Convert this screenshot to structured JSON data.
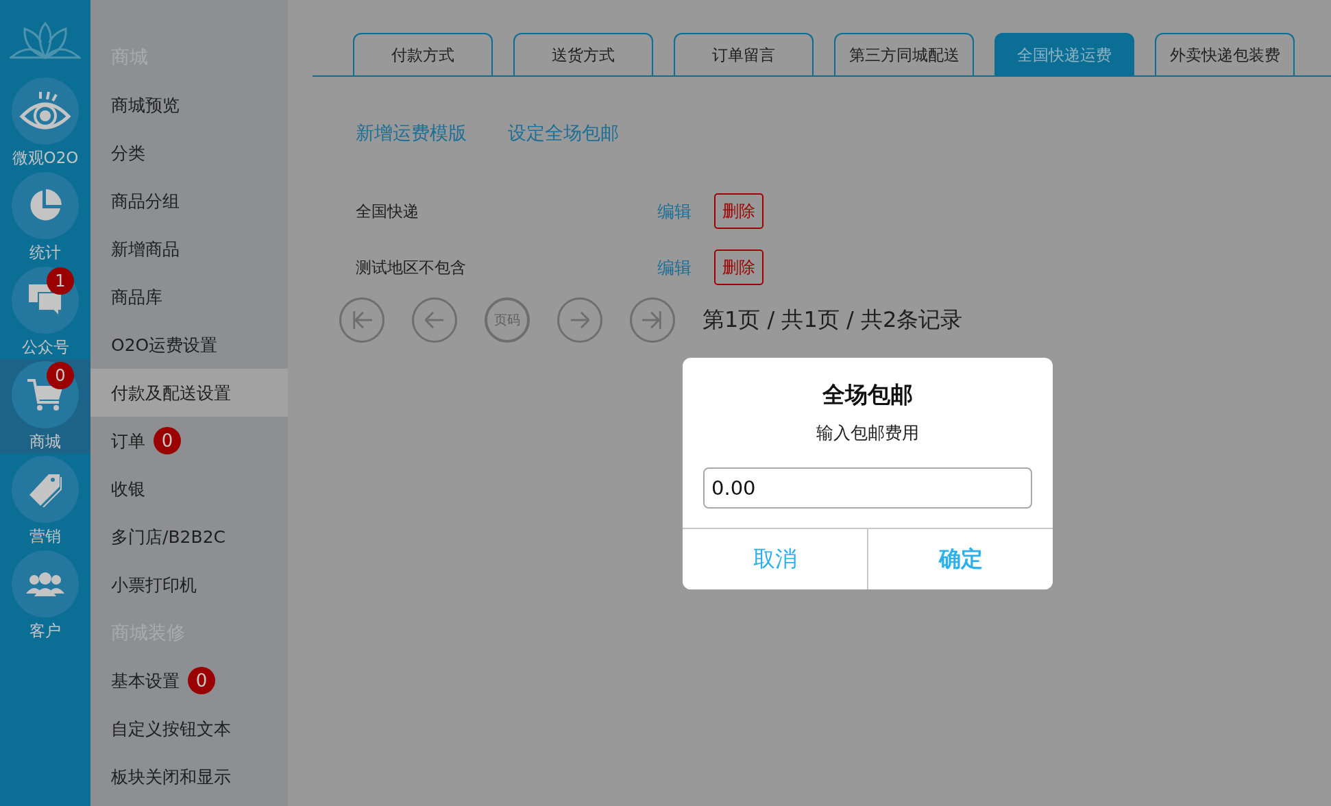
{
  "rail": {
    "items": [
      {
        "kind": "eye",
        "label": "微观O2O",
        "selected": false
      },
      {
        "kind": "pie",
        "label": "统计",
        "selected": false
      },
      {
        "kind": "chat",
        "label": "公众号",
        "badge": "1",
        "selected": false
      },
      {
        "kind": "cart",
        "label": "商城",
        "badge": "0",
        "selected": true
      },
      {
        "kind": "tag",
        "label": "营销",
        "selected": false
      },
      {
        "kind": "people",
        "label": "客户",
        "selected": false
      }
    ]
  },
  "sidebar": {
    "items": [
      {
        "kind": "header",
        "label": "商城"
      },
      {
        "kind": "item",
        "label": "商城预览",
        "selected": false
      },
      {
        "kind": "item",
        "label": "分类",
        "selected": false
      },
      {
        "kind": "item",
        "label": "商品分组",
        "selected": false
      },
      {
        "kind": "item",
        "label": "新增商品",
        "selected": false
      },
      {
        "kind": "item",
        "label": "商品库",
        "selected": false
      },
      {
        "kind": "item",
        "label": "O2O运费设置",
        "selected": false
      },
      {
        "kind": "item",
        "label": "付款及配送设置",
        "selected": true
      },
      {
        "kind": "item",
        "label": "订单",
        "badge": "0",
        "selected": false
      },
      {
        "kind": "item",
        "label": "收银",
        "selected": false
      },
      {
        "kind": "item",
        "label": "多门店/B2B2C",
        "selected": false
      },
      {
        "kind": "item",
        "label": "小票打印机",
        "selected": false
      },
      {
        "kind": "header",
        "label": "商城装修"
      },
      {
        "kind": "item",
        "label": "基本设置",
        "badge": "0",
        "selected": false
      },
      {
        "kind": "item",
        "label": "自定义按钮文本",
        "selected": false
      },
      {
        "kind": "item",
        "label": "板块关闭和显示",
        "selected": false
      }
    ]
  },
  "tabs": [
    {
      "label": "付款方式",
      "selected": false
    },
    {
      "label": "送货方式",
      "selected": false
    },
    {
      "label": "订单留言",
      "selected": false
    },
    {
      "label": "第三方同城配送",
      "selected": false
    },
    {
      "label": "全国快递运费",
      "selected": true
    },
    {
      "label": "外卖快递包装费",
      "selected": false
    }
  ],
  "actions": [
    "新增运费模版",
    "设定全场包邮"
  ],
  "templates": [
    {
      "name": "全国快递",
      "edit": "编辑",
      "delete": "删除"
    },
    {
      "name": "测试地区不包含",
      "edit": "编辑",
      "delete": "删除"
    }
  ],
  "pagination": {
    "buttons": [
      {
        "kind": "first"
      },
      {
        "kind": "prev"
      },
      {
        "kind": "page",
        "label": "页码"
      },
      {
        "kind": "next"
      },
      {
        "kind": "last"
      }
    ],
    "summary": "第1页 / 共1页 / 共2条记录"
  },
  "dialog": {
    "title": "全场包邮",
    "message": "输入包邮费用",
    "value": "0.00",
    "cancel": "取消",
    "confirm": "确定"
  }
}
